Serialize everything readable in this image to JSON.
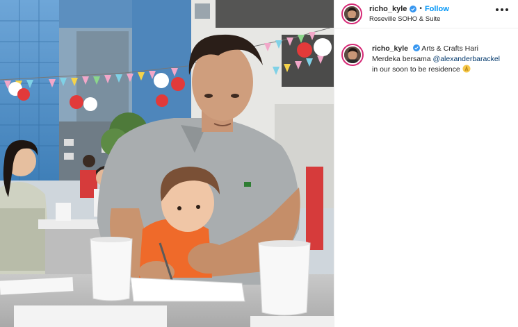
{
  "post": {
    "username": "richo_kyle",
    "follow_label": "Follow",
    "dot": "•",
    "location": "Roseville SOHO & Suite",
    "caption": {
      "username": "richo_kyle",
      "text_before": "Arts & Crafts Hari Merdeka bersama",
      "mention": "@alexanderbarackel",
      "text_after": "in our soon to be residence",
      "emoji": "folded-hands-emoji"
    }
  },
  "icons": {
    "verified": "verified-badge-icon",
    "more": "more-options-icon"
  },
  "colors": {
    "follow_blue": "#0095f6",
    "verified_blue": "#3897f0",
    "mention": "#00376b",
    "avatar_ring": "#d62976"
  }
}
